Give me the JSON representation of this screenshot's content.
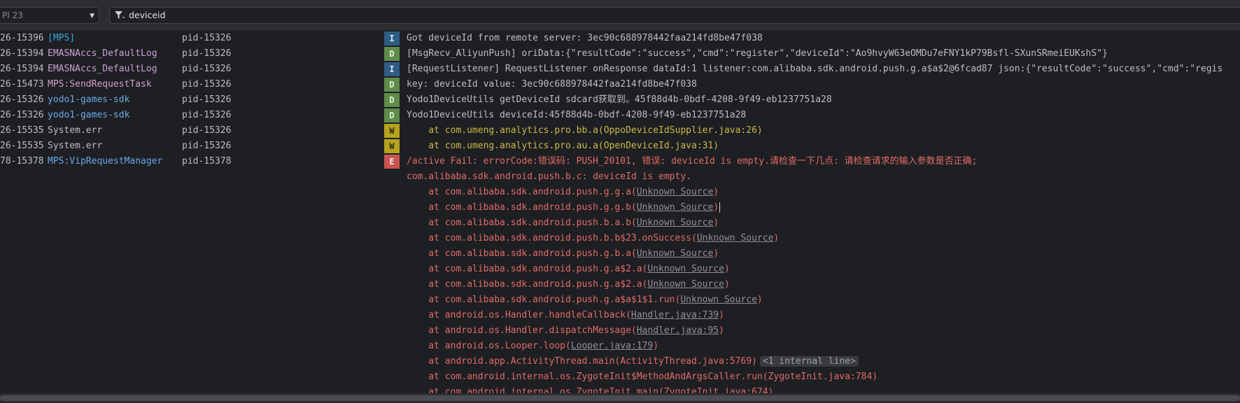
{
  "toolbar": {
    "device_select": "PI 23",
    "filter_value": "deviceid"
  },
  "colors": {
    "info": "#2f5c85",
    "debug": "#5f8c4a",
    "warn": "#b5a31e",
    "error": "#c75450",
    "tag_mps": "#4aa6d8",
    "tag_emas": "#c8a0d6",
    "tag_yodo": "#6aa9e8"
  },
  "log": {
    "rows": [
      {
        "time": "26-15396",
        "tag": "[MPS]",
        "tag_color": "#3aa7de",
        "pid": "pid-15326",
        "level": "I",
        "msg": "Got deviceId from remote server: 3ec90c688978442faa214fd8be47f038"
      },
      {
        "time": "26-15394",
        "tag": "EMASNAccs_DefaultLog",
        "tag_color": "#c8a0d6",
        "pid": "pid-15326",
        "level": "D",
        "msg": "[MsgRecv_AliyunPush] oriData:{\"resultCode\":\"success\",\"cmd\":\"register\",\"deviceId\":\"Ao9hvyW63eOMDu7eFNY1kP79Bsfl-SXunSRmeiEUKshS\"}"
      },
      {
        "time": "26-15394",
        "tag": "EMASNAccs_DefaultLog",
        "tag_color": "#c8a0d6",
        "pid": "pid-15326",
        "level": "I",
        "msg": "[RequestListener] RequestListener onResponse dataId:1 listener:com.alibaba.sdk.android.push.g.a$a$2@6fcad87 json:{\"resultCode\":\"success\",\"cmd\":\"regis"
      },
      {
        "time": "26-15473",
        "tag": "MPS:SendRequestTask",
        "tag_color": "#d4a0c8",
        "pid": "pid-15326",
        "level": "D",
        "msg": "key: deviceId value: 3ec90c688978442faa214fd8be47f038"
      },
      {
        "time": "26-15326",
        "tag": "yodo1-games-sdk",
        "tag_color": "#6aa9e8",
        "pid": "pid-15326",
        "level": "D",
        "msg": "Yodo1DeviceUtils getDeviceId sdcard获取到。45f88d4b-0bdf-4208-9f49-eb1237751a28"
      },
      {
        "time": "26-15326",
        "tag": "yodo1-games-sdk",
        "tag_color": "#6aa9e8",
        "pid": "pid-15326",
        "level": "D",
        "msg": "Yodo1DeviceUtils deviceId:45f88d4b-0bdf-4208-9f49-eb1237751a28"
      },
      {
        "time": "26-15535",
        "tag": "System.err",
        "tag_color": "#bcbec4",
        "pid": "pid-15326",
        "level": "W",
        "msg": "    at com.umeng.analytics.pro.bb.a(OppoDeviceIdSupplier.java:26)"
      },
      {
        "time": "26-15535",
        "tag": "System.err",
        "tag_color": "#bcbec4",
        "pid": "pid-15326",
        "level": "W",
        "msg": "    at com.umeng.analytics.pro.au.a(OpenDeviceId.java:31)"
      },
      {
        "time": "78-15378",
        "tag": "MPS:VipRequestManager",
        "tag_color": "#6aa9e8",
        "pid": "pid-15378",
        "level": "E",
        "msg": "/active Fail: errorCode:错误码: PUSH_20101, 错误: deviceId is empty.请检查一下几点: 请检查请求的输入参数是否正确;"
      }
    ],
    "stack": [
      {
        "pre": "com.alibaba.sdk.android.push.b.c: deviceId is empty.",
        "link": "",
        "post": "",
        "badge": "",
        "caret": false
      },
      {
        "pre": "    at com.alibaba.sdk.android.push.g.g.a(",
        "link": "Unknown Source",
        "post": ")",
        "badge": "",
        "caret": false
      },
      {
        "pre": "    at com.alibaba.sdk.android.push.g.g.b(",
        "link": "Unknown Source",
        "post": ")",
        "badge": "",
        "caret": true
      },
      {
        "pre": "    at com.alibaba.sdk.android.push.b.a.b(",
        "link": "Unknown Source",
        "post": ")",
        "badge": "",
        "caret": false
      },
      {
        "pre": "    at com.alibaba.sdk.android.push.b.b$23.onSuccess(",
        "link": "Unknown Source",
        "post": ")",
        "badge": "",
        "caret": false
      },
      {
        "pre": "    at com.alibaba.sdk.android.push.g.b.a(",
        "link": "Unknown Source",
        "post": ")",
        "badge": "",
        "caret": false
      },
      {
        "pre": "    at com.alibaba.sdk.android.push.g.a$2.a(",
        "link": "Unknown Source",
        "post": ")",
        "badge": "",
        "caret": false
      },
      {
        "pre": "    at com.alibaba.sdk.android.push.g.a$2.a(",
        "link": "Unknown Source",
        "post": ")",
        "badge": "",
        "caret": false
      },
      {
        "pre": "    at com.alibaba.sdk.android.push.g.a$a$1$1.run(",
        "link": "Unknown Source",
        "post": ")",
        "badge": "",
        "caret": false
      },
      {
        "pre": "    at android.os.Handler.handleCallback(",
        "link": "Handler.java:739",
        "post": ")",
        "badge": "",
        "caret": false
      },
      {
        "pre": "    at android.os.Handler.dispatchMessage(",
        "link": "Handler.java:95",
        "post": ")",
        "badge": "",
        "caret": false
      },
      {
        "pre": "    at android.os.Looper.loop(",
        "link": "Looper.java:179",
        "post": ")",
        "badge": "",
        "caret": false
      },
      {
        "pre": "    at android.app.ActivityThread.main(ActivityThread.java:5769)",
        "link": "",
        "post": "",
        "badge": "<1 internal line>",
        "caret": false
      },
      {
        "pre": "    at com.android.internal.os.ZygoteInit$MethodAndArgsCaller.run(ZygoteInit.java:784)",
        "link": "",
        "post": "",
        "badge": "",
        "caret": false
      },
      {
        "pre": "    at com.android.internal.os.ZygoteInit.main(ZygoteInit.java:674)",
        "link": "",
        "post": "",
        "badge": "",
        "caret": false
      }
    ]
  }
}
